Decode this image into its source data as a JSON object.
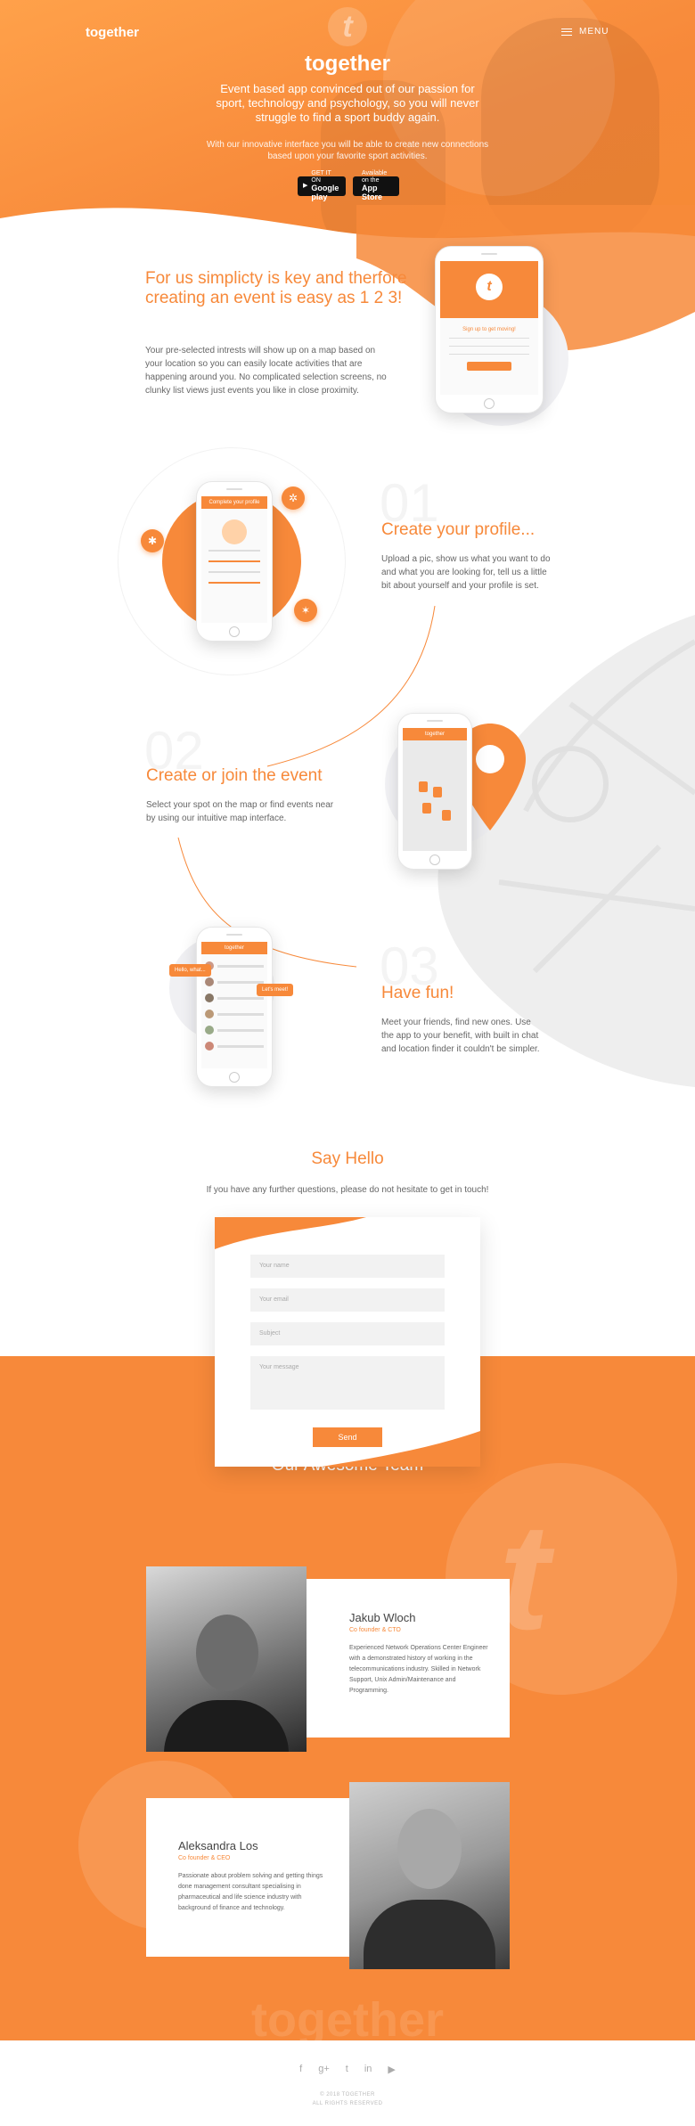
{
  "header": {
    "logo": "together",
    "menu_label": "MENU",
    "hero_mark": "t"
  },
  "hero": {
    "title": "together",
    "subtitle": "Event based app convinced out of our passion for sport, technology and psychology, so you will never struggle to find a sport buddy again.",
    "small_text": "With our innovative interface you will be able to create new connections based upon your favorite sport activities.",
    "google_top": "GET IT ON",
    "google_name": "Google play",
    "apple_top": "Available on the",
    "apple_name": "App Store"
  },
  "intro": {
    "heading": "For us simplicty is key and therfore creating an event is easy as 1 2 3!",
    "body": "Your pre-selected intrests will show up on a map based on your location so you can easily locate activities that are happening around you. No complicated selection screens, no clunky list views just events you like in close proximity.",
    "phone_title": "Sign up to get moving!"
  },
  "steps": [
    {
      "num": "01",
      "title": "Create your profile...",
      "body": "Upload a pic, show us what you want to do and what you are looking for, tell us a little bit about yourself and your profile is set.",
      "screen_title": "Complete your profile"
    },
    {
      "num": "02",
      "title": "Create or join the event",
      "body": "Select your spot on the map or find events near by using our intuitive map interface.",
      "screen_title": "together"
    },
    {
      "num": "03",
      "title": "Have fun!",
      "body": "Meet your friends, find new ones. Use the app to your benefit, with built in chat and location finder it couldn't be simpler.",
      "screen_title": "together"
    }
  ],
  "chat_bubbles": [
    "Hello, what...",
    "Let's meet!"
  ],
  "contact": {
    "title": "Say Hello",
    "subtitle": "If you have any further questions, please do not hesitate to get in touch!",
    "name_ph": "Your name",
    "email_ph": "Your email",
    "subject_ph": "Subject",
    "message_ph": "Your message",
    "send": "Send"
  },
  "team": {
    "title": "Our Awesome Team",
    "members": [
      {
        "name": "Jakub Wloch",
        "role": "Co founder & CTO",
        "bio": "Experienced Network Operations Center Engineer with a demonstrated history of working in the telecommunications industry. Skilled in Network Support, Unix Admin/Maintenance and Programming."
      },
      {
        "name": "Aleksandra Los",
        "role": "Co founder & CEO",
        "bio": "Passionate about problem solving and getting things done management consultant specialising in pharmaceutical and life science industry with background of finance and technology."
      }
    ],
    "watermark": "together"
  },
  "footer": {
    "icons": [
      "facebook-icon",
      "google-plus-icon",
      "twitter-icon",
      "linkedin-icon",
      "youtube-icon"
    ],
    "icon_glyphs": [
      "f",
      "g+",
      "t",
      "in",
      "▶"
    ],
    "copyright": "© 2018 TOGETHER",
    "rights": "ALL RIGHTS RESERVED"
  },
  "colors": {
    "accent": "#f7893a"
  }
}
